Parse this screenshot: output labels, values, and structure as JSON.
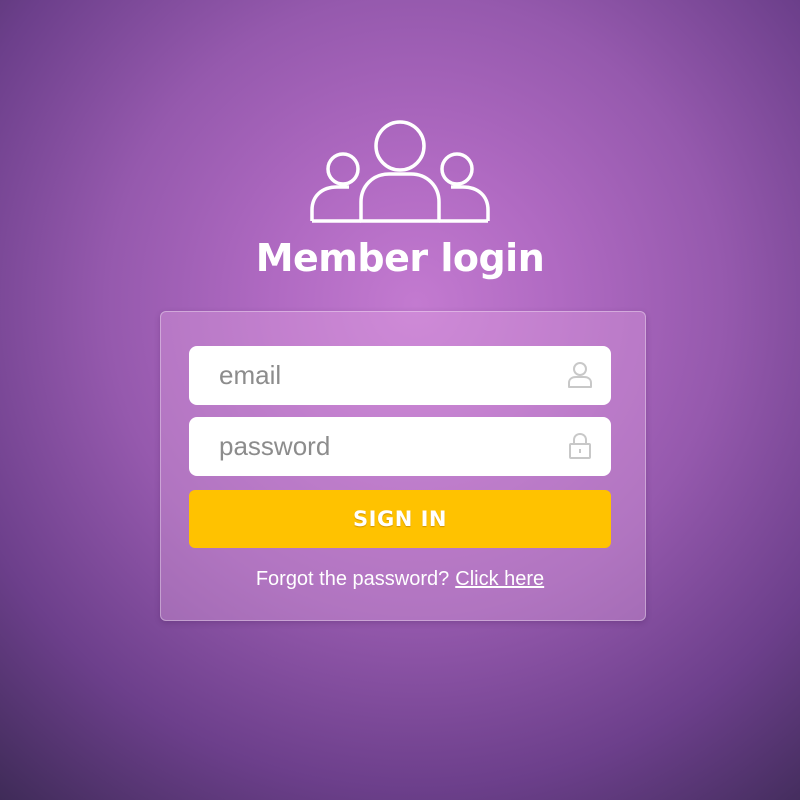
{
  "colors": {
    "background_center": "#c37ad0",
    "background_edge": "#3f2b58",
    "button": "#ffc200",
    "text": "#ffffff"
  },
  "header": {
    "icon": "members-icon",
    "title": "Member login"
  },
  "form": {
    "email": {
      "placeholder": "email",
      "value": "",
      "icon": "user-icon"
    },
    "password": {
      "placeholder": "password",
      "value": "",
      "icon": "lock-icon"
    },
    "submit_label": "SIGN IN",
    "forgot_text": "Forgot the password?",
    "forgot_link": "Click here"
  }
}
